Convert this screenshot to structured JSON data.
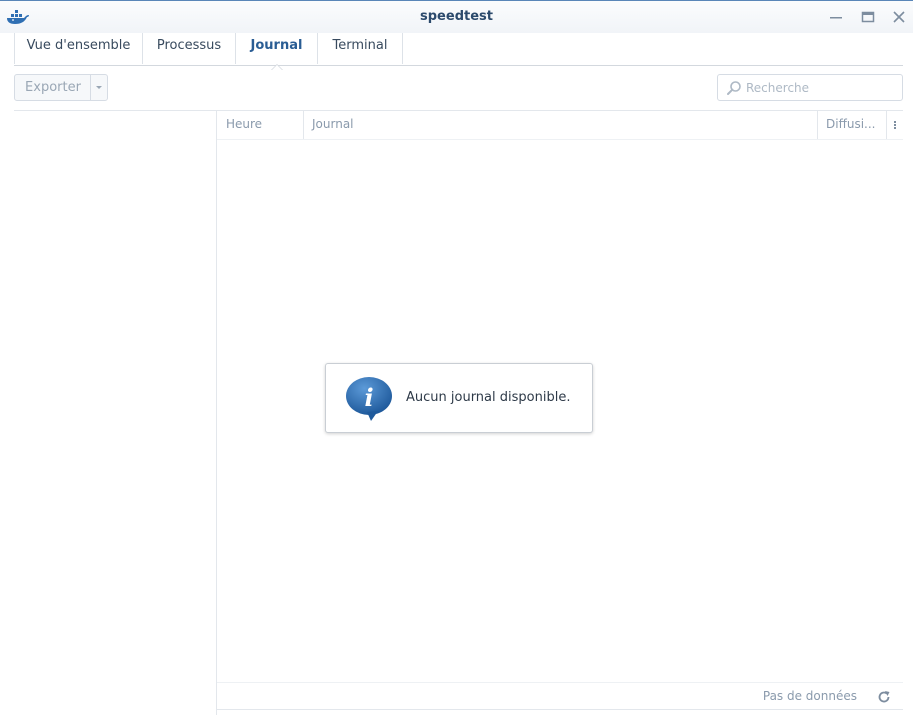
{
  "window": {
    "title": "speedtest",
    "app_icon": "docker-whale-icon",
    "controls": [
      "minimize-icon",
      "maximize-icon",
      "close-icon"
    ]
  },
  "tabs": [
    {
      "label": "Vue d'ensemble",
      "active": false
    },
    {
      "label": "Processus",
      "active": false
    },
    {
      "label": "Journal",
      "active": true
    },
    {
      "label": "Terminal",
      "active": false
    }
  ],
  "toolbar": {
    "export_label": "Exporter",
    "search_placeholder": "Recherche"
  },
  "grid": {
    "columns": [
      "Heure",
      "Journal",
      "Diffusi..."
    ],
    "rows": []
  },
  "empty_message": "Aucun journal disponible.",
  "footer": {
    "status": "Pas de données"
  },
  "colors": {
    "accent": "#2a5d94",
    "title": "#2c4a6c",
    "muted_text": "#8a9aac",
    "info_icon": "#2f6fb3"
  }
}
